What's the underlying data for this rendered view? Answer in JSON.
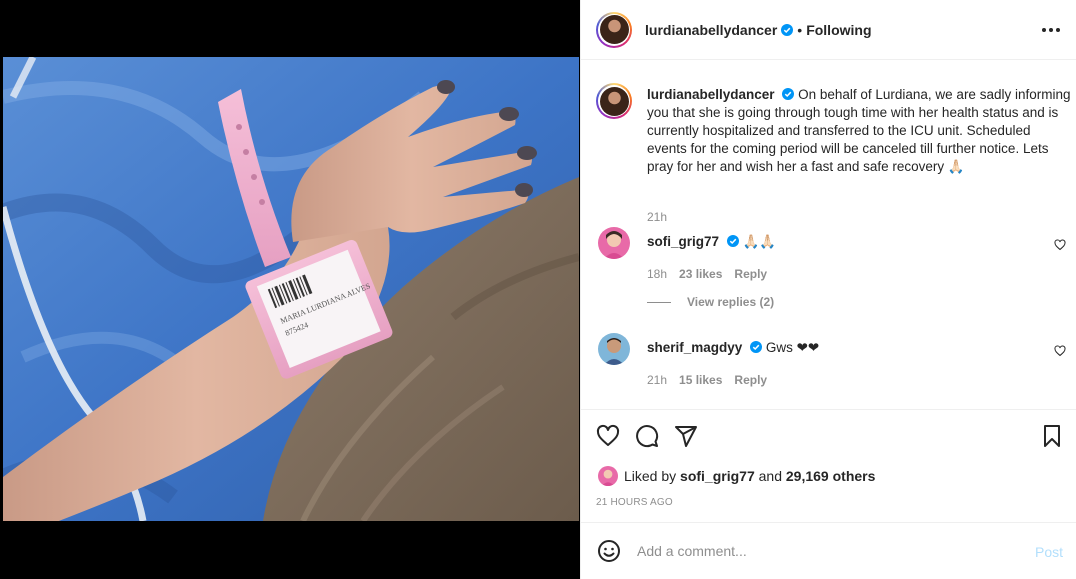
{
  "post": {
    "username": "lurdianabellydancer",
    "verified": true,
    "follow_status": "Following",
    "separator": "•"
  },
  "caption": {
    "username": "lurdianabellydancer",
    "text": "On behalf of Lurdiana, we are sadly informing you that she is going through tough time with her health status and is currently hospitalized and transferred to the ICU unit. Scheduled events for the coming period will be canceled till further notice. Lets pray for her and wish her a fast and safe recovery 🙏🏻",
    "time": "21h"
  },
  "comments": [
    {
      "username": "sofi_grig77",
      "verified": true,
      "text": "🙏🏻🙏🏻",
      "time": "18h",
      "likes": "23 likes",
      "reply": "Reply"
    },
    {
      "username": "sherif_magdyy",
      "verified": true,
      "text": "Gws ❤❤",
      "time": "21h",
      "likes": "15 likes",
      "reply": "Reply"
    }
  ],
  "view_replies": "View replies (2)",
  "likes": {
    "prefix": "Liked by",
    "user": "sofi_grig77",
    "connector": "and",
    "others": "29,169 others"
  },
  "timestamp": "21 HOURS AGO",
  "comment_box": {
    "placeholder": "Add a comment...",
    "post_label": "Post"
  },
  "photo": {
    "wristband_lines": [
      "MARIA LURDIANA ALVES",
      "875424"
    ]
  },
  "icons": {
    "like": "heart-icon",
    "comment": "comment-icon",
    "share": "share-icon",
    "save": "bookmark-icon",
    "more": "more-options-icon",
    "emoji": "emoji-icon",
    "verified": "verified-badge-icon"
  },
  "colors": {
    "verified": "#0095f6",
    "post_disabled": "#b2dffc",
    "muted": "#8e8e8e",
    "text": "#262626"
  }
}
